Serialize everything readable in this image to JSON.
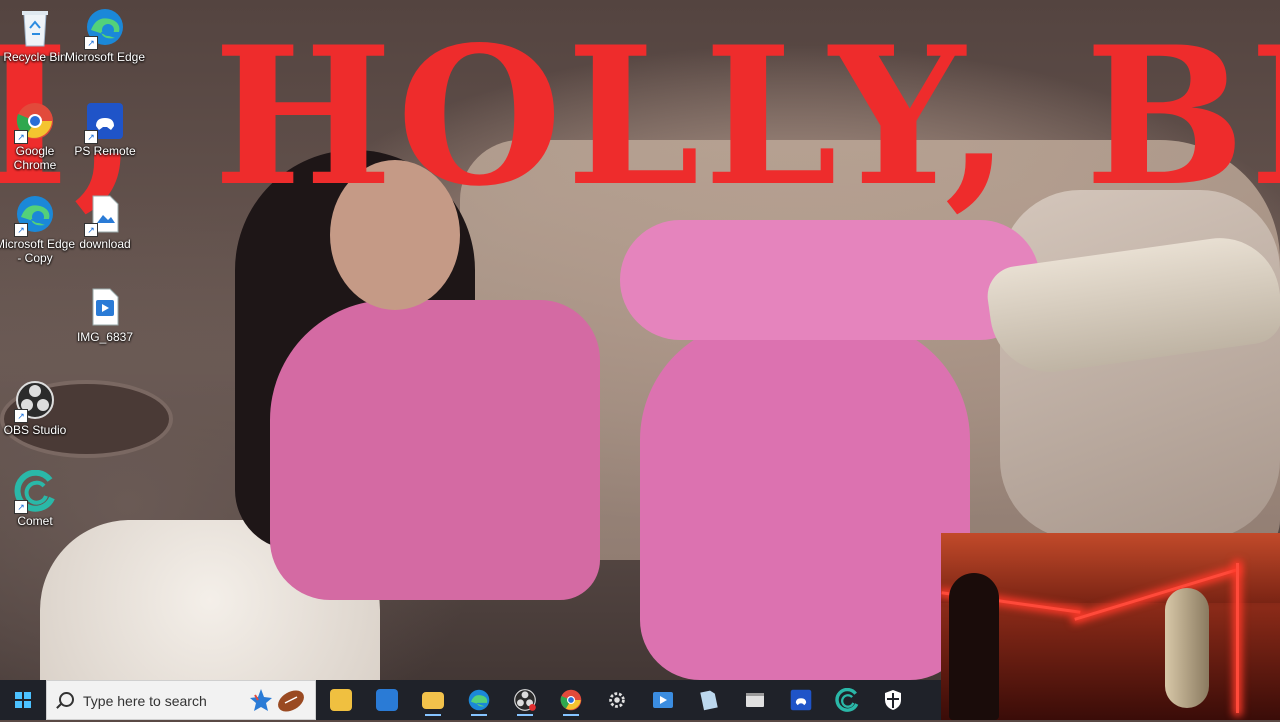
{
  "wallpaper": {
    "headline": "I, HOLLY, BR",
    "headline_color": "#ee2c2c"
  },
  "desktop": {
    "icons": [
      {
        "label": "Recycle Bin",
        "icon": "recycle-bin-icon"
      },
      {
        "label": "Microsoft Edge",
        "icon": "edge-icon"
      },
      {
        "label": "Google Chrome",
        "icon": "chrome-icon"
      },
      {
        "label": "PS Remote",
        "icon": "ps-remote-icon"
      },
      {
        "label": "Microsoft Edge - Copy",
        "icon": "edge-icon"
      },
      {
        "label": "download",
        "icon": "image-file-icon"
      },
      {
        "label": "IMG_6837",
        "icon": "video-file-icon"
      },
      {
        "label": "OBS Studio",
        "icon": "obs-icon"
      },
      {
        "label": "Comet",
        "icon": "comet-icon"
      }
    ]
  },
  "taskbar": {
    "search_placeholder": "Type here to search",
    "apps": [
      {
        "name": "widgets",
        "icon": "widgets-icon",
        "color": "#f0c040"
      },
      {
        "name": "outlook",
        "icon": "outlook-icon",
        "color": "#2a7bd6"
      },
      {
        "name": "file-explorer",
        "icon": "folder-icon",
        "color": "#f2c24b"
      },
      {
        "name": "edge",
        "icon": "edge-icon",
        "color": "#2fa0e0"
      },
      {
        "name": "obs",
        "icon": "obs-icon",
        "color": "#d0d0d0"
      },
      {
        "name": "chrome",
        "icon": "chrome-icon",
        "color": "#e24a3b"
      },
      {
        "name": "settings",
        "icon": "gear-icon",
        "color": "#e0e0e0"
      },
      {
        "name": "media-player",
        "icon": "media-player-icon",
        "color": "#3b8de0"
      },
      {
        "name": "files",
        "icon": "file-icon",
        "color": "#bcd8ee"
      },
      {
        "name": "window",
        "icon": "window-icon",
        "color": "#e0e0e0"
      },
      {
        "name": "ps-remote",
        "icon": "ps-remote-icon",
        "color": "#2a5fd0"
      },
      {
        "name": "comet",
        "icon": "comet-icon",
        "color": "#2ab8a8"
      },
      {
        "name": "security",
        "icon": "shield-icon",
        "color": "#ffffff"
      }
    ]
  },
  "webcam": {
    "led_color": "#ff4a3a"
  }
}
